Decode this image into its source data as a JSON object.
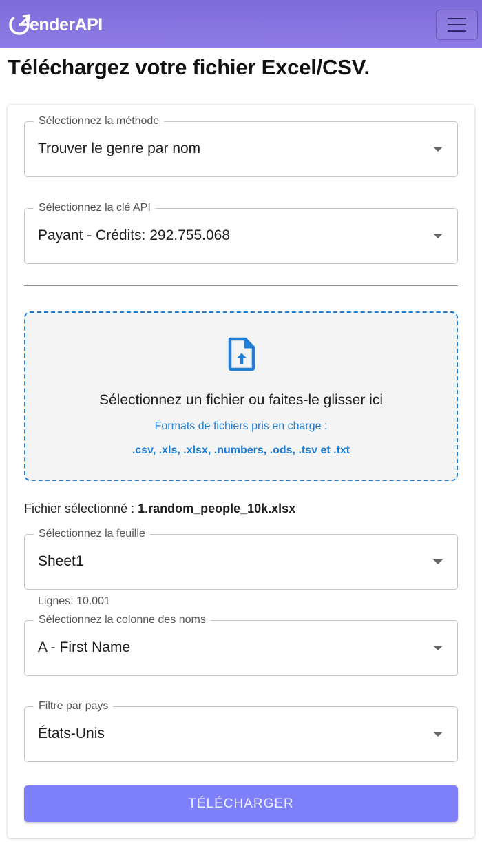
{
  "navbar": {
    "brand": "enderAPI",
    "logo_icon": "genderapi-logo-icon",
    "menu_icon": "hamburger-menu-icon",
    "background": "#8672dd"
  },
  "page": {
    "title": "Téléchargez votre fichier Excel/CSV."
  },
  "form": {
    "method": {
      "label": "Sélectionnez la méthode",
      "value": "Trouver le genre par nom"
    },
    "api_key": {
      "label": "Sélectionnez la clé API",
      "value": "Payant - Crédits: 292.755.068"
    },
    "dropzone": {
      "icon": "file-upload-icon",
      "main_text": "Sélectionnez un fichier ou faites-le glisser ici",
      "formats_label": "Formats de fichiers pris en charge :",
      "formats": ".csv, .xls, .xlsx, .numbers, .ods, .tsv et .txt",
      "accent": "#1f7fd6"
    },
    "selected_file": {
      "label": "Fichier sélectionné :",
      "name": "1.random_people_10k.xlsx"
    },
    "sheet": {
      "label": "Sélectionnez la feuille",
      "value": "Sheet1",
      "helper": "Lignes: 10.001"
    },
    "name_column": {
      "label": "Sélectionnez la colonne des noms",
      "value": "A - First Name"
    },
    "country_filter": {
      "label": "Filtre par pays",
      "value": "États-Unis"
    },
    "submit": {
      "label": "TÉLÉCHARGER",
      "color": "#7d80fa"
    }
  }
}
